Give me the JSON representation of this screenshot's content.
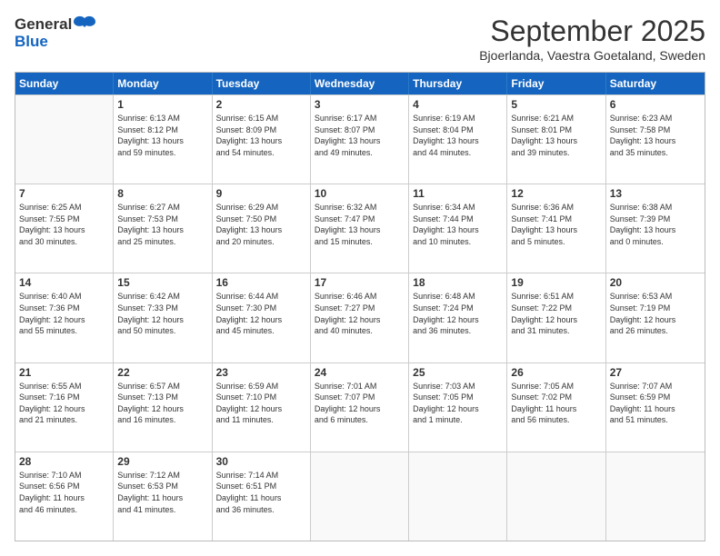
{
  "logo": {
    "line1": "General",
    "line2": "Blue"
  },
  "title": "September 2025",
  "location": "Bjoerlanda, Vaestra Goetaland, Sweden",
  "headers": [
    "Sunday",
    "Monday",
    "Tuesday",
    "Wednesday",
    "Thursday",
    "Friday",
    "Saturday"
  ],
  "weeks": [
    [
      {
        "day": "",
        "info": ""
      },
      {
        "day": "1",
        "info": "Sunrise: 6:13 AM\nSunset: 8:12 PM\nDaylight: 13 hours\nand 59 minutes."
      },
      {
        "day": "2",
        "info": "Sunrise: 6:15 AM\nSunset: 8:09 PM\nDaylight: 13 hours\nand 54 minutes."
      },
      {
        "day": "3",
        "info": "Sunrise: 6:17 AM\nSunset: 8:07 PM\nDaylight: 13 hours\nand 49 minutes."
      },
      {
        "day": "4",
        "info": "Sunrise: 6:19 AM\nSunset: 8:04 PM\nDaylight: 13 hours\nand 44 minutes."
      },
      {
        "day": "5",
        "info": "Sunrise: 6:21 AM\nSunset: 8:01 PM\nDaylight: 13 hours\nand 39 minutes."
      },
      {
        "day": "6",
        "info": "Sunrise: 6:23 AM\nSunset: 7:58 PM\nDaylight: 13 hours\nand 35 minutes."
      }
    ],
    [
      {
        "day": "7",
        "info": "Sunrise: 6:25 AM\nSunset: 7:55 PM\nDaylight: 13 hours\nand 30 minutes."
      },
      {
        "day": "8",
        "info": "Sunrise: 6:27 AM\nSunset: 7:53 PM\nDaylight: 13 hours\nand 25 minutes."
      },
      {
        "day": "9",
        "info": "Sunrise: 6:29 AM\nSunset: 7:50 PM\nDaylight: 13 hours\nand 20 minutes."
      },
      {
        "day": "10",
        "info": "Sunrise: 6:32 AM\nSunset: 7:47 PM\nDaylight: 13 hours\nand 15 minutes."
      },
      {
        "day": "11",
        "info": "Sunrise: 6:34 AM\nSunset: 7:44 PM\nDaylight: 13 hours\nand 10 minutes."
      },
      {
        "day": "12",
        "info": "Sunrise: 6:36 AM\nSunset: 7:41 PM\nDaylight: 13 hours\nand 5 minutes."
      },
      {
        "day": "13",
        "info": "Sunrise: 6:38 AM\nSunset: 7:39 PM\nDaylight: 13 hours\nand 0 minutes."
      }
    ],
    [
      {
        "day": "14",
        "info": "Sunrise: 6:40 AM\nSunset: 7:36 PM\nDaylight: 12 hours\nand 55 minutes."
      },
      {
        "day": "15",
        "info": "Sunrise: 6:42 AM\nSunset: 7:33 PM\nDaylight: 12 hours\nand 50 minutes."
      },
      {
        "day": "16",
        "info": "Sunrise: 6:44 AM\nSunset: 7:30 PM\nDaylight: 12 hours\nand 45 minutes."
      },
      {
        "day": "17",
        "info": "Sunrise: 6:46 AM\nSunset: 7:27 PM\nDaylight: 12 hours\nand 40 minutes."
      },
      {
        "day": "18",
        "info": "Sunrise: 6:48 AM\nSunset: 7:24 PM\nDaylight: 12 hours\nand 36 minutes."
      },
      {
        "day": "19",
        "info": "Sunrise: 6:51 AM\nSunset: 7:22 PM\nDaylight: 12 hours\nand 31 minutes."
      },
      {
        "day": "20",
        "info": "Sunrise: 6:53 AM\nSunset: 7:19 PM\nDaylight: 12 hours\nand 26 minutes."
      }
    ],
    [
      {
        "day": "21",
        "info": "Sunrise: 6:55 AM\nSunset: 7:16 PM\nDaylight: 12 hours\nand 21 minutes."
      },
      {
        "day": "22",
        "info": "Sunrise: 6:57 AM\nSunset: 7:13 PM\nDaylight: 12 hours\nand 16 minutes."
      },
      {
        "day": "23",
        "info": "Sunrise: 6:59 AM\nSunset: 7:10 PM\nDaylight: 12 hours\nand 11 minutes."
      },
      {
        "day": "24",
        "info": "Sunrise: 7:01 AM\nSunset: 7:07 PM\nDaylight: 12 hours\nand 6 minutes."
      },
      {
        "day": "25",
        "info": "Sunrise: 7:03 AM\nSunset: 7:05 PM\nDaylight: 12 hours\nand 1 minute."
      },
      {
        "day": "26",
        "info": "Sunrise: 7:05 AM\nSunset: 7:02 PM\nDaylight: 11 hours\nand 56 minutes."
      },
      {
        "day": "27",
        "info": "Sunrise: 7:07 AM\nSunset: 6:59 PM\nDaylight: 11 hours\nand 51 minutes."
      }
    ],
    [
      {
        "day": "28",
        "info": "Sunrise: 7:10 AM\nSunset: 6:56 PM\nDaylight: 11 hours\nand 46 minutes."
      },
      {
        "day": "29",
        "info": "Sunrise: 7:12 AM\nSunset: 6:53 PM\nDaylight: 11 hours\nand 41 minutes."
      },
      {
        "day": "30",
        "info": "Sunrise: 7:14 AM\nSunset: 6:51 PM\nDaylight: 11 hours\nand 36 minutes."
      },
      {
        "day": "",
        "info": ""
      },
      {
        "day": "",
        "info": ""
      },
      {
        "day": "",
        "info": ""
      },
      {
        "day": "",
        "info": ""
      }
    ]
  ]
}
